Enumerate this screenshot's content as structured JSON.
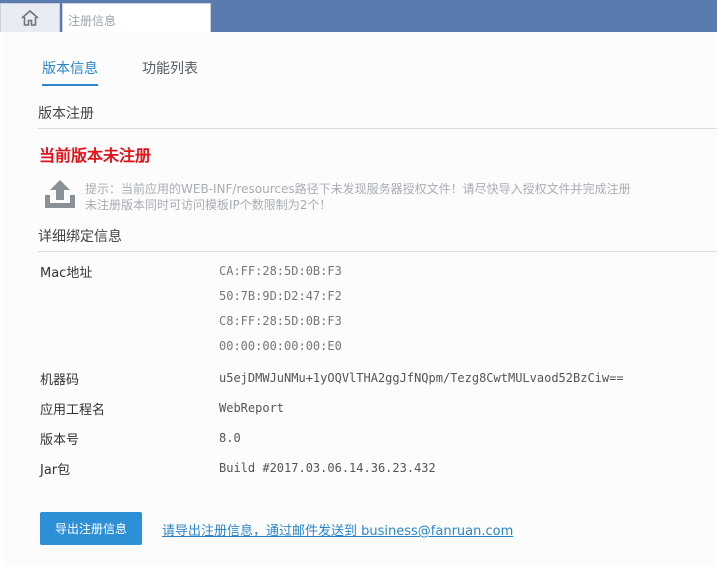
{
  "header": {
    "active_tab": "注册信息",
    "icons": {
      "home": "home-icon"
    }
  },
  "tabs": [
    {
      "label": "版本信息",
      "selected": true
    },
    {
      "label": "功能列表",
      "selected": false
    }
  ],
  "version_register": {
    "title": "版本注册",
    "status": "当前版本未注册",
    "hint_line1": "提示：当前应用的WEB-INF/resources路径下未发现服务器授权文件！请尽快导入授权文件并完成注册",
    "hint_line2": "未注册版本同时可访问模板IP个数限制为2个！",
    "icon": "upload-icon"
  },
  "details": {
    "title": "详细绑定信息",
    "mac_label": "Mac地址",
    "mac_values": [
      "CA:FF:28:5D:0B:F3",
      "50:7B:9D:D2:47:F2",
      "C8:FF:28:5D:0B:F3",
      "00:00:00:00:00:E0"
    ],
    "machine_label": "机器码",
    "machine_value": "u5ejDMWJuNMu+1yOQVlTHA2ggJfNQpm/Tezg8CwtMULvaod52BzCiw==",
    "project_label": "应用工程名",
    "project_value": "WebReport",
    "version_label": "版本号",
    "version_value": "8.0",
    "jar_label": "Jar包",
    "jar_value": "Build #2017.03.06.14.36.23.432"
  },
  "footer": {
    "export_label": "导出注册信息",
    "mail_text": "请导出注册信息，通过邮件发送到 business@fanruan.com"
  },
  "colors": {
    "topbar": "#5a7bb0",
    "accent": "#2a86c9",
    "error": "#e2131a",
    "button": "#2d8fd5"
  }
}
